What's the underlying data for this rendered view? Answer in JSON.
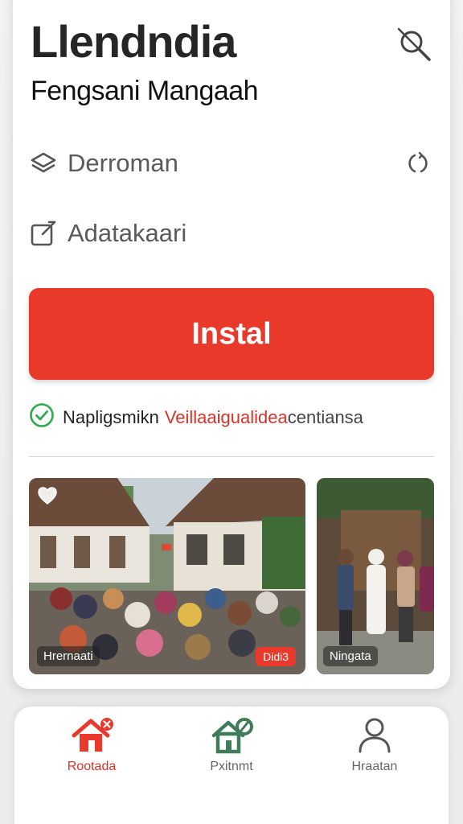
{
  "header": {
    "title": "Llendndia",
    "subtitle": "Fengsani Mangaah"
  },
  "menu": {
    "items": [
      {
        "label": "Derroman",
        "icon": "layers-icon"
      },
      {
        "label": "Adatakaari",
        "icon": "edit-icon"
      }
    ]
  },
  "install": {
    "label": "Instal"
  },
  "verified": {
    "text_1": "Napligsmikn",
    "text_2": "Veillaaigualidea",
    "text_3": "centiansa"
  },
  "gallery": {
    "photos": [
      {
        "caption": "Hrernaati",
        "badge": "Didi3"
      },
      {
        "caption": "Ningata"
      }
    ]
  },
  "tabs": [
    {
      "label": "Rootada",
      "icon": "home-icon",
      "active": true
    },
    {
      "label": "Pxitnmt",
      "icon": "building-icon",
      "active": false
    },
    {
      "label": "Hraatan",
      "icon": "user-icon",
      "active": false
    }
  ],
  "colors": {
    "accent": "#e8392b",
    "success": "#2fa84f",
    "secondary_green": "#3f7d5a",
    "text_dark": "#262626",
    "text_muted": "#5a5a5a"
  }
}
